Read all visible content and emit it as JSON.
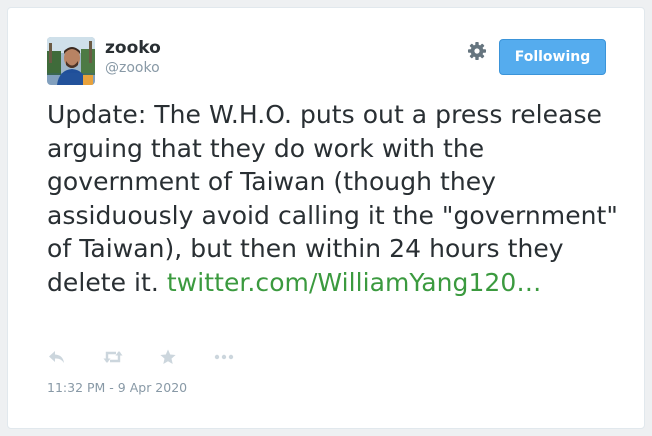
{
  "user": {
    "name": "zooko",
    "handle": "@zooko",
    "avatar_icon": "profile-photo"
  },
  "header": {
    "settings_icon": "gear-icon",
    "follow_button_label": "Following"
  },
  "tweet": {
    "text": "Update: The W.H.O. puts out a press release arguing that they do work with the government of Taiwan (though they assiduously avoid calling it the \"government\" of Taiwan), but then within 24 hours they delete it.",
    "link_text": "twitter.com/WilliamYang120…"
  },
  "actions": [
    {
      "name": "reply",
      "icon": "reply-icon"
    },
    {
      "name": "retweet",
      "icon": "retweet-icon"
    },
    {
      "name": "like",
      "icon": "star-icon"
    },
    {
      "name": "more",
      "icon": "more-icon"
    }
  ],
  "timestamp": "11:32 PM - 9 Apr 2020",
  "colors": {
    "follow_button": "#55acee",
    "link": "#3b9a3f",
    "text": "#292f33",
    "muted": "#8899a6"
  }
}
